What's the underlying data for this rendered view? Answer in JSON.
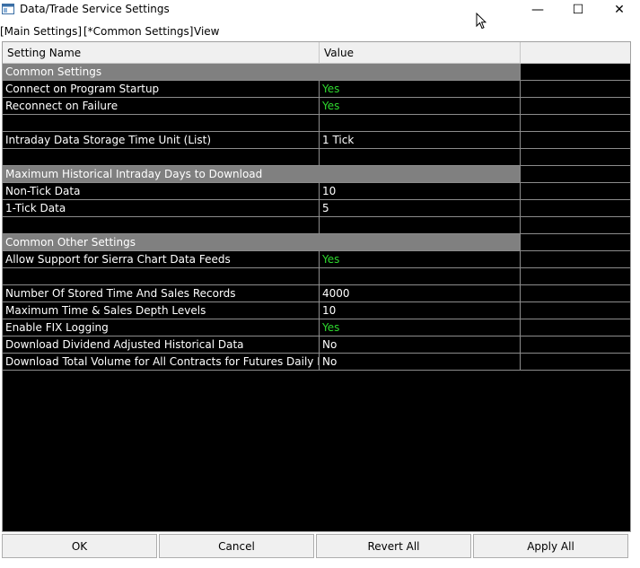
{
  "window": {
    "title": "Data/Trade Service Settings",
    "minimize_glyph": "—",
    "maximize_glyph": "☐",
    "close_glyph": "✕"
  },
  "menu": [
    {
      "label": "[Main Settings]"
    },
    {
      "label": "[*Common Settings]"
    },
    {
      "label": "View"
    }
  ],
  "grid": {
    "columns": [
      "Setting Name",
      "Value",
      ""
    ],
    "rows": [
      {
        "type": "section",
        "name": "Common Settings",
        "value": ""
      },
      {
        "type": "setting",
        "name": "Connect on Program Startup",
        "value": "Yes",
        "value_color": "#2ed82e"
      },
      {
        "type": "setting",
        "name": "Reconnect on Failure",
        "value": "Yes",
        "value_color": "#2ed82e"
      },
      {
        "type": "blank",
        "name": "",
        "value": ""
      },
      {
        "type": "setting",
        "name": "Intraday Data Storage Time Unit (List)",
        "value": "1 Tick"
      },
      {
        "type": "blank",
        "name": "",
        "value": ""
      },
      {
        "type": "section",
        "name": "Maximum Historical Intraday Days to Download",
        "value": ""
      },
      {
        "type": "setting",
        "name": "Non-Tick Data",
        "value": "10"
      },
      {
        "type": "setting",
        "name": "1-Tick Data",
        "value": "5"
      },
      {
        "type": "blank",
        "name": "",
        "value": ""
      },
      {
        "type": "section",
        "name": "Common Other Settings",
        "value": ""
      },
      {
        "type": "setting",
        "name": "Allow Support for Sierra Chart Data Feeds",
        "value": "Yes",
        "value_color": "#2ed82e"
      },
      {
        "type": "blank",
        "name": "",
        "value": ""
      },
      {
        "type": "setting",
        "name": "Number Of Stored Time And Sales Records",
        "value": "4000"
      },
      {
        "type": "setting",
        "name": "Maximum Time & Sales Depth Levels",
        "value": "10"
      },
      {
        "type": "setting",
        "name": "Enable FIX Logging",
        "value": "Yes",
        "value_color": "#2ed82e"
      },
      {
        "type": "setting",
        "name": "Download Dividend Adjusted Historical Data",
        "value": "No"
      },
      {
        "type": "setting",
        "name": "Download Total Volume for All Contracts for Futures Daily Data",
        "value": "No"
      }
    ]
  },
  "buttons": {
    "ok": "OK",
    "cancel": "Cancel",
    "revert_all": "Revert All",
    "apply_all": "Apply All"
  },
  "colors": {
    "grid_background": "#000000",
    "section_background": "#808080",
    "yes_value": "#2ed82e"
  }
}
